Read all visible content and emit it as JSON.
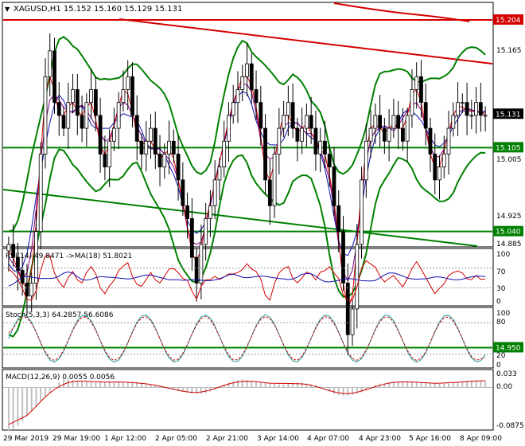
{
  "main": {
    "title_arrow": "▼",
    "title": "XAGUSD,H1  15.152 15.160 15.129 15.131",
    "y_ticks": [
      "15.204",
      "15.165",
      "15.131",
      "15.105",
      "15.040",
      "15.005",
      "14.950",
      "14.925",
      "14.885"
    ],
    "plain_ticks": [
      "15.165",
      "15.005",
      "14.925",
      "14.885"
    ],
    "levels": [
      {
        "price": 15.204,
        "label": "15.204",
        "color": "#d40000"
      },
      {
        "price": 15.131,
        "label": "15.131",
        "color": "#000000"
      },
      {
        "price": 15.105,
        "label": "15.105",
        "color": "#008000"
      },
      {
        "price": 15.04,
        "label": "15.040",
        "color": "#008000"
      },
      {
        "price": 14.95,
        "label": "14.950",
        "color": "#008000"
      }
    ]
  },
  "rsi": {
    "title": "RSI(14) 49.8471  ->MA(18) 51.8021",
    "y_ticks": [
      "100",
      "70",
      "30",
      "0"
    ]
  },
  "stoch": {
    "title": "Stoch(5,3,3) 64.2857 56.6086",
    "y_ticks": [
      "100",
      "80",
      "20",
      "0"
    ]
  },
  "macd": {
    "title": "MACD(12,26,9) 0.0055 0.0056",
    "y_ticks": [
      "0.033",
      "0.00",
      "-0.0875"
    ]
  },
  "x_ticks": [
    "29 Mar 2019",
    "29 Mar 19:00",
    "1 Apr 12:00",
    "2 Apr 05:00",
    "2 Apr 21:00",
    "3 Apr 14:00",
    "4 Apr 07:00",
    "4 Apr 23:00",
    "5 Apr 16:00",
    "8 Apr 09:00"
  ],
  "chart_data": {
    "type": "candlestick",
    "symbol": "XAGUSD",
    "timeframe": "H1",
    "last_bar": {
      "open": 15.152,
      "high": 15.16,
      "low": 15.129,
      "close": 15.131
    },
    "ylim": [
      14.885,
      15.225
    ],
    "close_series": [
      15.03,
      15.02,
      15.01,
      15.0,
      14.99,
      15.0,
      15.04,
      15.1,
      15.16,
      15.18,
      15.14,
      15.13,
      15.12,
      15.14,
      15.15,
      15.13,
      15.12,
      15.14,
      15.15,
      15.13,
      15.1,
      15.09,
      15.11,
      15.12,
      15.14,
      15.15,
      15.16,
      15.13,
      15.11,
      15.1,
      15.11,
      15.12,
      15.1,
      15.09,
      15.1,
      15.11,
      15.1,
      15.08,
      15.06,
      15.05,
      15.02,
      15.0,
      15.03,
      15.05,
      15.06,
      15.08,
      15.09,
      15.11,
      15.13,
      15.14,
      15.15,
      15.16,
      15.17,
      15.15,
      15.14,
      15.12,
      15.08,
      15.06,
      15.1,
      15.12,
      15.13,
      15.14,
      15.12,
      15.11,
      15.12,
      15.13,
      15.12,
      15.1,
      15.11,
      15.1,
      15.09,
      15.06,
      15.04,
      15.0,
      14.96,
      14.98,
      15.03,
      15.08,
      15.11,
      15.12,
      15.13,
      15.12,
      15.11,
      15.12,
      15.13,
      15.12,
      15.11,
      15.13,
      15.15,
      15.16,
      15.14,
      15.12,
      15.1,
      15.08,
      15.09,
      15.1,
      15.12,
      15.13,
      15.14,
      15.14,
      15.13,
      15.13,
      15.14,
      15.13,
      15.13
    ],
    "rsi": {
      "value": 49.8471,
      "ma_period": 18,
      "ma_value": 51.8021,
      "ylim": [
        0,
        100
      ],
      "levels": [
        30,
        70
      ]
    },
    "stochastic": {
      "params": [
        5,
        3,
        3
      ],
      "main": 64.2857,
      "signal": 56.6086,
      "ylim": [
        0,
        100
      ],
      "levels": [
        20,
        80
      ]
    },
    "macd": {
      "params": [
        12,
        26,
        9
      ],
      "macd": 0.0055,
      "signal": 0.0056,
      "ylim": [
        -0.0875,
        0.033
      ]
    },
    "colors": {
      "bull": "#008000",
      "bear": "#d40000",
      "rsi": "#1010b0",
      "rsi_ma": "#d40000",
      "stoch_main": "#20a0a0",
      "stoch_signal": "#d40000",
      "macd_hist": "#c0c0c0",
      "macd_signal": "#d40000"
    }
  }
}
